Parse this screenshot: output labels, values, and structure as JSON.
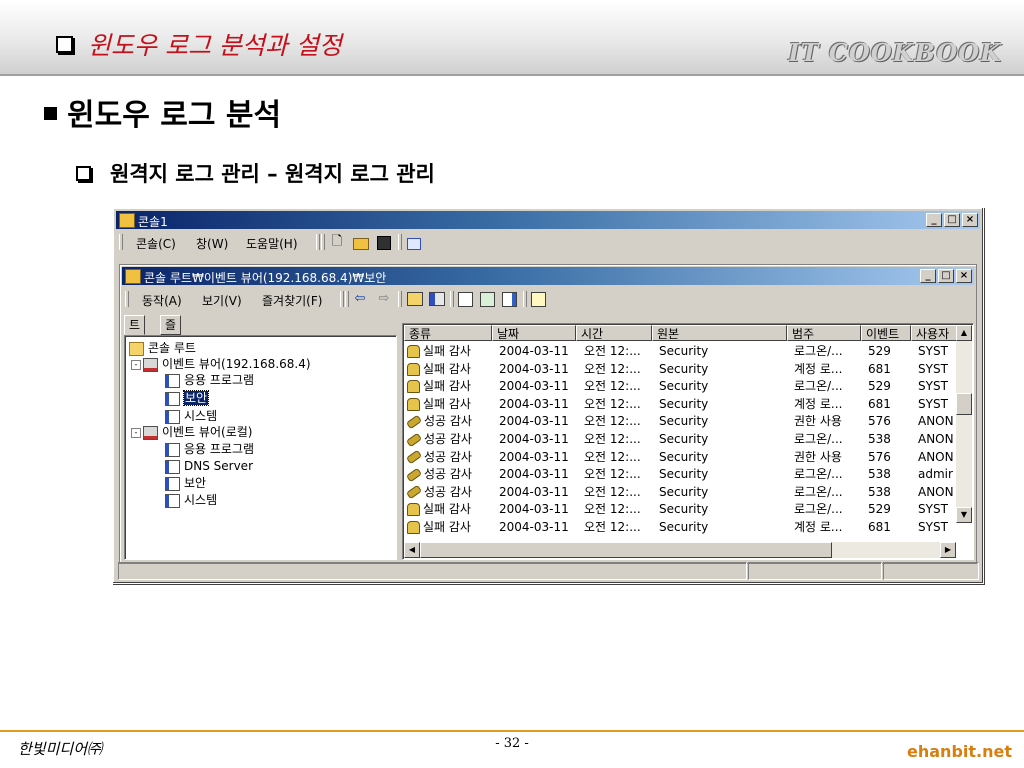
{
  "header": {
    "section_title": "윈도우 로그 분석과 설정",
    "brand": "IT COOKBOOK"
  },
  "main_heading": "윈도우 로그 분석",
  "sub_heading": "원격지 로그 관리 – 원격지 로그 관리",
  "console": {
    "title": "콘솔1",
    "menu": [
      "콘솔(C)",
      "창(W)",
      "도움말(H)"
    ],
    "caption_buttons": [
      "_",
      "□",
      "×"
    ],
    "child": {
      "title": "콘솔 루트₩이벤트 뷰어(192.168.68.4)₩보안",
      "menu": [
        "동작(A)",
        "보기(V)",
        "즐겨찾기(F)"
      ],
      "tabs": [
        "트리",
        "즐겨찾기"
      ],
      "tree": [
        {
          "label": "콘솔 루트",
          "icon": "folder-icon",
          "indent": 0,
          "expander": ""
        },
        {
          "label": "이벤트 뷰어(192.168.68.4)",
          "icon": "event-viewer-icon",
          "indent": 1,
          "expander": "-"
        },
        {
          "label": "응용 프로그램",
          "icon": "log-icon",
          "indent": 2,
          "expander": ""
        },
        {
          "label": "보안",
          "icon": "log-icon",
          "indent": 2,
          "expander": "",
          "selected": true
        },
        {
          "label": "시스템",
          "icon": "log-icon",
          "indent": 2,
          "expander": ""
        },
        {
          "label": "이벤트 뷰어(로컬)",
          "icon": "event-viewer-icon",
          "indent": 1,
          "expander": "-"
        },
        {
          "label": "응용 프로그램",
          "icon": "log-icon",
          "indent": 2,
          "expander": ""
        },
        {
          "label": "DNS Server",
          "icon": "log-icon",
          "indent": 2,
          "expander": ""
        },
        {
          "label": "보안",
          "icon": "log-icon",
          "indent": 2,
          "expander": ""
        },
        {
          "label": "시스템",
          "icon": "log-icon",
          "indent": 2,
          "expander": ""
        }
      ],
      "columns": [
        "종류",
        "날짜",
        "시간",
        "원본",
        "범주",
        "이벤트",
        "사용자"
      ],
      "rows": [
        {
          "type": "실패 감사",
          "icon": "lock-icon",
          "date": "2004-03-11",
          "time": "오전 12:...",
          "source": "Security",
          "category": "로그온/...",
          "event": "529",
          "user": "SYST"
        },
        {
          "type": "실패 감사",
          "icon": "lock-icon",
          "date": "2004-03-11",
          "time": "오전 12:...",
          "source": "Security",
          "category": "계정 로...",
          "event": "681",
          "user": "SYST"
        },
        {
          "type": "실패 감사",
          "icon": "lock-icon",
          "date": "2004-03-11",
          "time": "오전 12:...",
          "source": "Security",
          "category": "로그온/...",
          "event": "529",
          "user": "SYST"
        },
        {
          "type": "실패 감사",
          "icon": "lock-icon",
          "date": "2004-03-11",
          "time": "오전 12:...",
          "source": "Security",
          "category": "계정 로...",
          "event": "681",
          "user": "SYST"
        },
        {
          "type": "성공 감사",
          "icon": "key-icon",
          "date": "2004-03-11",
          "time": "오전 12:...",
          "source": "Security",
          "category": "권한 사용",
          "event": "576",
          "user": "ANON"
        },
        {
          "type": "성공 감사",
          "icon": "key-icon",
          "date": "2004-03-11",
          "time": "오전 12:...",
          "source": "Security",
          "category": "로그온/...",
          "event": "538",
          "user": "ANON"
        },
        {
          "type": "성공 감사",
          "icon": "key-icon",
          "date": "2004-03-11",
          "time": "오전 12:...",
          "source": "Security",
          "category": "권한 사용",
          "event": "576",
          "user": "ANON"
        },
        {
          "type": "성공 감사",
          "icon": "key-icon",
          "date": "2004-03-11",
          "time": "오전 12:...",
          "source": "Security",
          "category": "로그온/...",
          "event": "538",
          "user": "admir"
        },
        {
          "type": "성공 감사",
          "icon": "key-icon",
          "date": "2004-03-11",
          "time": "오전 12:...",
          "source": "Security",
          "category": "로그온/...",
          "event": "538",
          "user": "ANON"
        },
        {
          "type": "실패 감사",
          "icon": "lock-icon",
          "date": "2004-03-11",
          "time": "오전 12:...",
          "source": "Security",
          "category": "로그온/...",
          "event": "529",
          "user": "SYST"
        },
        {
          "type": "실패 감사",
          "icon": "lock-icon",
          "date": "2004-03-11",
          "time": "오전 12:...",
          "source": "Security",
          "category": "계정 로...",
          "event": "681",
          "user": "SYST"
        }
      ]
    }
  },
  "footer": {
    "publisher": "한빛미디어㈜",
    "page": "- 32 -",
    "site": "ehanbit.net"
  },
  "colors": {
    "title_red": "#c3101a",
    "titlebar_start": "#0a246a",
    "titlebar_end": "#a6caf0",
    "footer_orange": "#d97f10"
  }
}
